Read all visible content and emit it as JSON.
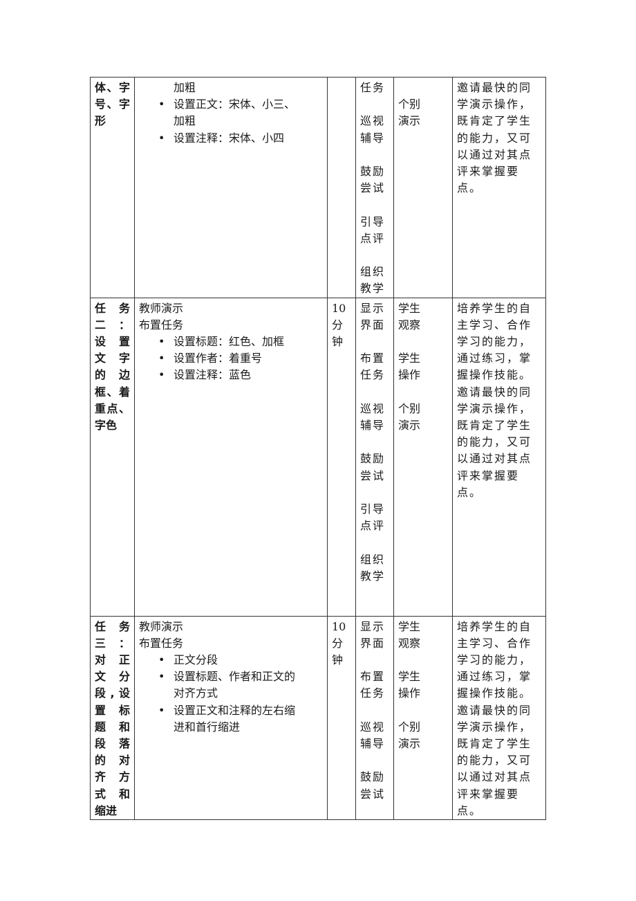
{
  "rows": [
    {
      "topic_lines": [
        "体、字",
        "号、字",
        "形"
      ],
      "content": {
        "intro_lines": [],
        "continuation": "加粗",
        "bullets": [
          [
            "设置正文：宋体、小三、",
            "加粗"
          ],
          [
            "设置注释：宋体、小四"
          ]
        ]
      },
      "time_lines": [],
      "teacher_groups": [
        [
          "任务"
        ],
        [
          "巡视",
          "辅导"
        ],
        [
          "鼓励",
          "尝试"
        ],
        [
          "引导",
          "点评"
        ],
        [
          "组织",
          "教学"
        ]
      ],
      "student_groups": [
        [
          "个别",
          "演示"
        ]
      ],
      "intent_lines": [
        "邀请最快的同",
        "学演示操作，",
        "既肯定了学生",
        "的能力，又可",
        "以通过对其点",
        "评来掌握要点。"
      ]
    },
    {
      "topic_lines": [
        "任 务",
        "二：",
        "设 置",
        "文 字",
        "的 边",
        "框、着",
        "重点、",
        "字色"
      ],
      "content": {
        "intro_lines": [
          "教师演示",
          "布置任务"
        ],
        "continuation": "",
        "bullets": [
          [
            "设置标题：红色、加框"
          ],
          [
            "设置作者：着重号"
          ],
          [
            "设置注释：蓝色"
          ]
        ]
      },
      "time_lines": [
        "10",
        "分",
        "钟"
      ],
      "teacher_groups": [
        [
          "显示",
          "界面"
        ],
        [
          "布置",
          "任务"
        ],
        [
          "巡视",
          "辅导"
        ],
        [
          "鼓励",
          "尝试"
        ],
        [
          "引导",
          "点评"
        ],
        [
          "组织",
          "教学"
        ]
      ],
      "student_groups": [
        [
          "学生",
          "观察"
        ],
        [
          "学生",
          "操作"
        ],
        [
          "个别",
          "演示"
        ]
      ],
      "intent_lines": [
        "培养学生的自",
        "主学习、合作",
        "学习的能力，",
        "通过练习，掌",
        "握操作技能。",
        "邀请最快的同",
        "学演示操作，",
        "既肯定了学生",
        "的能力，又可",
        "以通过对其点",
        "评来掌握要点。"
      ]
    },
    {
      "topic_lines": [
        "任 务",
        "三：",
        "对 正",
        "文 分",
        "段,设",
        "置 标",
        "题 和",
        "段 落",
        "的 对",
        "齐 方",
        "式 和",
        "缩进"
      ],
      "content": {
        "intro_lines": [
          "教师演示",
          "布置任务"
        ],
        "continuation": "",
        "bullets": [
          [
            "正文分段"
          ],
          [
            "设置标题、作者和正文的",
            "对齐方式"
          ],
          [
            "设置正文和注释的左右缩",
            "进和首行缩进"
          ]
        ]
      },
      "time_lines": [
        "10",
        "分",
        "钟"
      ],
      "teacher_groups": [
        [
          "显示",
          "界面"
        ],
        [
          "布置",
          "任务"
        ],
        [
          "巡视",
          "辅导"
        ],
        [
          "鼓励",
          "尝试"
        ]
      ],
      "student_groups": [
        [
          "学生",
          "观察"
        ],
        [
          "学生",
          "操作"
        ],
        [
          "个别",
          "演示"
        ]
      ],
      "intent_lines": [
        "培养学生的自",
        "主学习、合作",
        "学习的能力，",
        "通过练习，掌",
        "握操作技能。",
        "邀请最快的同",
        "学演示操作，",
        "既肯定了学生",
        "的能力，又可",
        "以通过对其点",
        "评来掌握要点。"
      ]
    }
  ]
}
